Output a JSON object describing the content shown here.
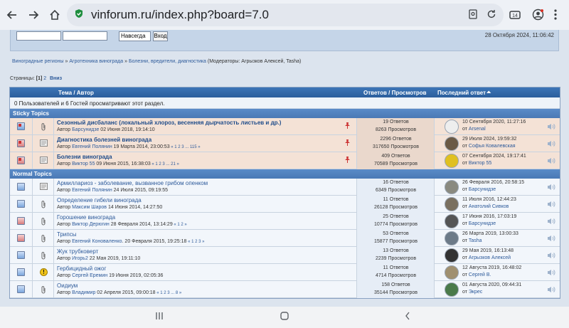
{
  "browser": {
    "url": "vinforum.ru/index.php?board=7.0"
  },
  "login": {
    "session_option": "Навсегда",
    "login_label": "Вход",
    "datetime": "28 Октября 2024, 11:06:42"
  },
  "breadcrumbs": {
    "item1": "Виноградные регионы",
    "sep": "»",
    "item2": "Агротехника винограда",
    "item3": "Болезни, вредители, диагностика",
    "moderators": "(Модераторы: Агрызков Алексей, Tasha)"
  },
  "pagination": {
    "label": "Страницы:",
    "current": "[1]",
    "next": "2",
    "down": "Вниз"
  },
  "table": {
    "col_topic": "Тема / Автор",
    "col_replies": "Ответов / Просмотров",
    "col_lastpost": "Последний ответ",
    "viewing": "0 Пользователей и 6 Гостей просматривают этот раздел.",
    "sticky_header": "Sticky Topics",
    "normal_header": "Normal Topics"
  },
  "sticky": [
    {
      "title": "Сезонный дисбаланс (локальный хлороз, весенняя дырчатость листьев и др.)",
      "by": "Автор ",
      "user": "Барсунидзе",
      "date": " 02 Июня 2018, 19:14:10",
      "pages": "",
      "replies": "19 Ответов",
      "views": "8263 Просмотров",
      "lp_date": "10 Сентября 2020, 11:27:16",
      "lp_by": "от ",
      "lp_user": "Arsenal"
    },
    {
      "title": "Диагностика болезней винограда",
      "by": "Автор ",
      "user": "Евгений Полянин",
      "date": " 19 Марта 2014, 23:00:53",
      "pages": " « 1 2 3 ... 115 »",
      "replies": "2296 Ответов",
      "views": "317650 Просмотров",
      "lp_date": "29 Июля 2024, 19:59:32",
      "lp_by": "от ",
      "lp_user": "Софья Ковалевская"
    },
    {
      "title": "Болезни винограда",
      "by": "Автор ",
      "user": "Виктор 55",
      "date": " 09 Июня 2015, 16:38:03",
      "pages": " « 1 2 3 ... 21 »",
      "replies": "409 Ответов",
      "views": "70589 Просмотров",
      "lp_date": "07 Сентября 2024, 19:17:41",
      "lp_by": "от ",
      "lp_user": "Виктор 55"
    }
  ],
  "normal": [
    {
      "title": "Армиллариоз - заболевание, вызванное грибом опенком",
      "by": "Автор ",
      "user": "Евгений Полянин",
      "date": " 24 Июля 2015, 09:19:55",
      "pages": "",
      "replies": "16 Ответов",
      "views": "6349 Просмотров",
      "lp_date": "26 Февраля 2016, 20:58:15",
      "lp_by": "от ",
      "lp_user": "Барсунидзе"
    },
    {
      "title": "Определение гибели винограда",
      "by": "Автор ",
      "user": "Максим Шаров",
      "date": " 14 Июня 2014, 14:27:50",
      "pages": "",
      "replies": "11 Ответов",
      "views": "26128 Просмотров",
      "lp_date": "11 Июля 2016, 12:44:23",
      "lp_by": "от ",
      "lp_user": "Анатолий Сивков"
    },
    {
      "title": "Горошение винограда",
      "by": "Автор ",
      "user": "Виктор Дерюгин",
      "date": " 28 Февраля 2014, 13:14:29",
      "pages": " « 1 2 »",
      "replies": "25 Ответов",
      "views": "10774 Просмотров",
      "lp_date": "17 Июня 2016, 17:03:19",
      "lp_by": "от ",
      "lp_user": "Барсунидзе"
    },
    {
      "title": "Трипсы",
      "by": "Автор ",
      "user": "Евгений Коноваленко",
      "date": ". 20 Февраля 2015, 19:25:18",
      "pages": " « 1 2 3 »",
      "replies": "53 Ответов",
      "views": "15877 Просмотров",
      "lp_date": "26 Марта 2019, 13:00:33",
      "lp_by": "от ",
      "lp_user": "Tasha"
    },
    {
      "title": "Жук трубковерт",
      "by": "Автор ",
      "user": "Игорь2",
      "date": " 22 Мая 2019, 19:11:10",
      "pages": "",
      "replies": "13 Ответов",
      "views": "2239 Просмотров",
      "lp_date": "29 Мая 2019, 16:13:48",
      "lp_by": "от ",
      "lp_user": "Агрызков Алексей"
    },
    {
      "title": "Гербицидный ожог",
      "by": "Автор ",
      "user": "Сергей Еремин",
      "date": " 19 Июня 2019, 02:05:36",
      "pages": "",
      "replies": "11 Ответов",
      "views": "4714 Просмотров",
      "lp_date": "12 Августа 2019, 16:48:02",
      "lp_by": "от ",
      "lp_user": "Сергей В."
    },
    {
      "title": "Оидиум",
      "by": "Автор ",
      "user": "Владимир",
      "date": " 02 Апреля 2015, 09:00:18",
      "pages": " « 1 2 3 ... 8 »",
      "replies": "158 Ответов",
      "views": "35144 Просмотров",
      "lp_date": "01 Августа 2020, 09:44:31",
      "lp_by": "от ",
      "lp_user": "Экрес"
    }
  ],
  "icons": {
    "back": "arrow-left-icon",
    "forward": "arrow-right-icon",
    "home": "home-icon",
    "secure": "shield-check-icon",
    "pin": "pushpin-icon",
    "speaker": "speaker-icon"
  },
  "colors": {
    "header_blue": "#2b5e9c",
    "sticky_bg": "#f4e2d6",
    "link": "#2d5a9a"
  }
}
